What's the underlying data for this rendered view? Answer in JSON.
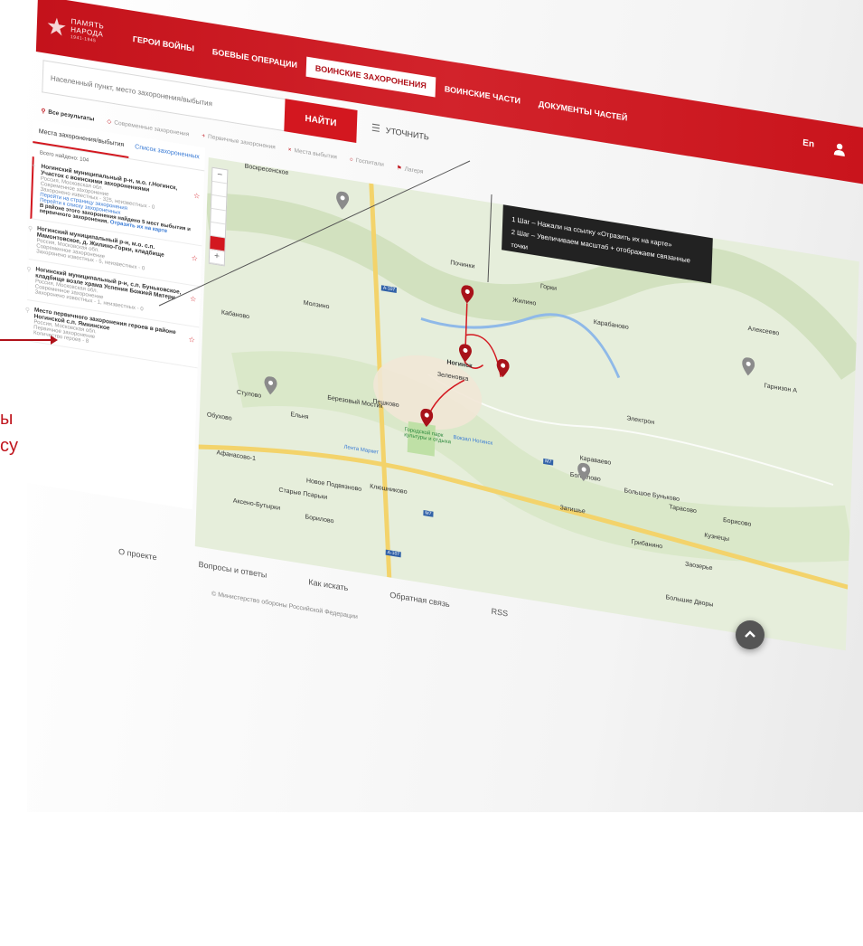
{
  "header": {
    "logo": {
      "line1": "ПАМЯТЬ",
      "line2": "НАРОДА",
      "years": "1941-1945"
    },
    "nav": [
      {
        "label": "ГЕРОИ ВОЙНЫ",
        "active": false
      },
      {
        "label": "БОЕВЫЕ ОПЕРАЦИИ",
        "active": false
      },
      {
        "label": "ВОИНСКИЕ ЗАХОРОНЕНИЯ",
        "active": true
      },
      {
        "label": "ВОИНСКИЕ ЧАСТИ",
        "active": false
      },
      {
        "label": "ДОКУМЕНТЫ ЧАСТЕЙ",
        "active": false
      }
    ],
    "lang": "En",
    "accent": "#d3171f"
  },
  "search": {
    "placeholder": "Населенный пункт, место захоронения/выбытия",
    "button": "НАЙТИ",
    "refine": "УТОЧНИТЬ"
  },
  "filters": [
    {
      "label": "Все результаты",
      "active": true
    },
    {
      "label": "Современные захоронения",
      "active": false
    },
    {
      "label": "Первичные захоронения",
      "active": false
    },
    {
      "label": "Места выбытия",
      "active": false
    },
    {
      "label": "Госпитали",
      "active": false
    },
    {
      "label": "Лагеря",
      "active": false
    }
  ],
  "panel": {
    "tabs": [
      "Места захоронения/выбытия",
      "Список захороненных"
    ],
    "count": "Всего найдено: 104",
    "results": [
      {
        "title": "Ногинский муниципальный р-н, м.о. г.Ногинск, Участок с воинскими захоронениями",
        "lines": [
          "Россия, Московская обл.",
          "Современное захоронение",
          "Захоронено известных - 325, неизвестных - 0"
        ],
        "links": [
          "Перейти на страницу захоронения",
          "Перейти к списку захороненных"
        ],
        "note": "В районе этого захоронения найдено 5 мест выбытия и первичного захоронения.",
        "note_link": "Отразить их на карте"
      },
      {
        "title": "Ногинский муниципальный р-н, м.о. с.п. Мамонтовское, д. Жилино-Горки, кладбище",
        "lines": [
          "Россия, Московская обл.",
          "Современное захоронение",
          "Захоронено известных - 5, неизвестных - 0"
        ],
        "links": [],
        "note": "",
        "note_link": ""
      },
      {
        "title": "Ногинский муниципальный р-н, с.п. Буньковское, кладбище возле храма Успения Божией Матери",
        "lines": [
          "Россия, Московская обл.",
          "Современное захоронение",
          "Захоронено известных - 1, неизвестных - 0"
        ],
        "links": [],
        "note": "",
        "note_link": ""
      },
      {
        "title": "Место первичного захоронения героев в районе Ногинской с.п. Ямкинское",
        "lines": [
          "Россия, Московская обл.",
          "Первичное захоронение",
          "Количество героев - 8"
        ],
        "links": [],
        "note": "",
        "note_link": ""
      }
    ]
  },
  "tooltip": {
    "step1": "1 Шаг – Нажали на ссылку «Отразить их на карте»",
    "step2": "2 Шаг – Увеличиваем масштаб + отображаем связанные точки"
  },
  "map": {
    "towns": [
      "Воскресенское",
      "Починки",
      "Горки",
      "Жилино",
      "Карабаново",
      "Алексеево",
      "Молзино",
      "Кабаново",
      "Ногинск",
      "Зеленовка",
      "Гарнизон А",
      "Электрон",
      "Стулово",
      "Ельня",
      "Березовый Мостик",
      "Пешково",
      "Караваево",
      "Богослово",
      "Обухово",
      "Афанасово-1",
      "Новое Подвязново",
      "Старые Псарьки",
      "Клюшниково",
      "Аксено-Бутырки",
      "Борилово",
      "Большое Буньково",
      "Тарасово",
      "Борисово",
      "Кузнецы",
      "Затишье",
      "Грибанино",
      "Заозерье",
      "Большие Дворы"
    ],
    "roads": [
      "А-107",
      "М7",
      "А-107",
      "М7"
    ],
    "park": "Городской парк культуры и отдыха",
    "station": "Вокзал Ногинск",
    "shop": "Лента Маркет"
  },
  "footer": {
    "links": [
      "О проекте",
      "Вопросы и ответы",
      "Как искать",
      "Обратная связь",
      "RSS"
    ],
    "copyright": "© Министерство обороны Российской Федерации"
  },
  "annotation": {
    "line1": "ы",
    "line2": "су",
    "color": "#c0161e"
  }
}
